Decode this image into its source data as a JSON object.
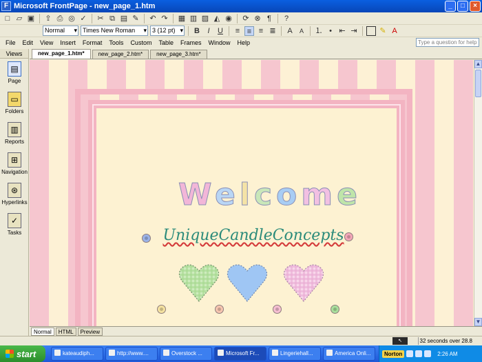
{
  "window": {
    "title": "Microsoft FrontPage - new_page_1.htm"
  },
  "toolbar_format": {
    "style": "Normal",
    "font": "Times New Roman",
    "size": "3 (12 pt)"
  },
  "menu": [
    "File",
    "Edit",
    "View",
    "Insert",
    "Format",
    "Tools",
    "Custom",
    "Table",
    "Frames",
    "Window",
    "Help"
  ],
  "help_box": {
    "placeholder": "Type a question for help"
  },
  "views": {
    "header": "Views",
    "items": [
      {
        "label": "Page",
        "icon": "page-view-icon"
      },
      {
        "label": "Folders",
        "icon": "folder-icon"
      },
      {
        "label": "Reports",
        "icon": "reports-icon"
      },
      {
        "label": "Navigation",
        "icon": "navigation-icon"
      },
      {
        "label": "Hyperlinks",
        "icon": "hyperlinks-icon"
      },
      {
        "label": "Tasks",
        "icon": "tasks-icon"
      }
    ]
  },
  "doc_tabs": [
    "new_page_1.htm*",
    "new_page_2.htm*",
    "new_page_3.htm*"
  ],
  "page": {
    "welcome_letters": [
      "W",
      "e",
      "l",
      "c",
      "o",
      "m",
      "e"
    ],
    "subtitle": "UniqueCandleConcepts",
    "heart_colors": [
      "#b7e0a5",
      "#9fc6f4",
      "#f1c4e0"
    ]
  },
  "view_tabs": [
    "Normal",
    "HTML",
    "Preview"
  ],
  "status": {
    "speed": "32 seconds over 28.8"
  },
  "taskbar": {
    "start": "start",
    "tasks": [
      "kateaudiph...",
      "http://www....",
      "Overstock ...",
      "Microsoft Fr...",
      "Lingeriehall...",
      "America Onli..."
    ],
    "norton": "Norton",
    "clock": "2:26 AM"
  },
  "colors": {
    "stripe_pink": "#f6c6cf",
    "stripe_cream": "#fdf1d5",
    "xp_blue": "#0a5fe0"
  }
}
